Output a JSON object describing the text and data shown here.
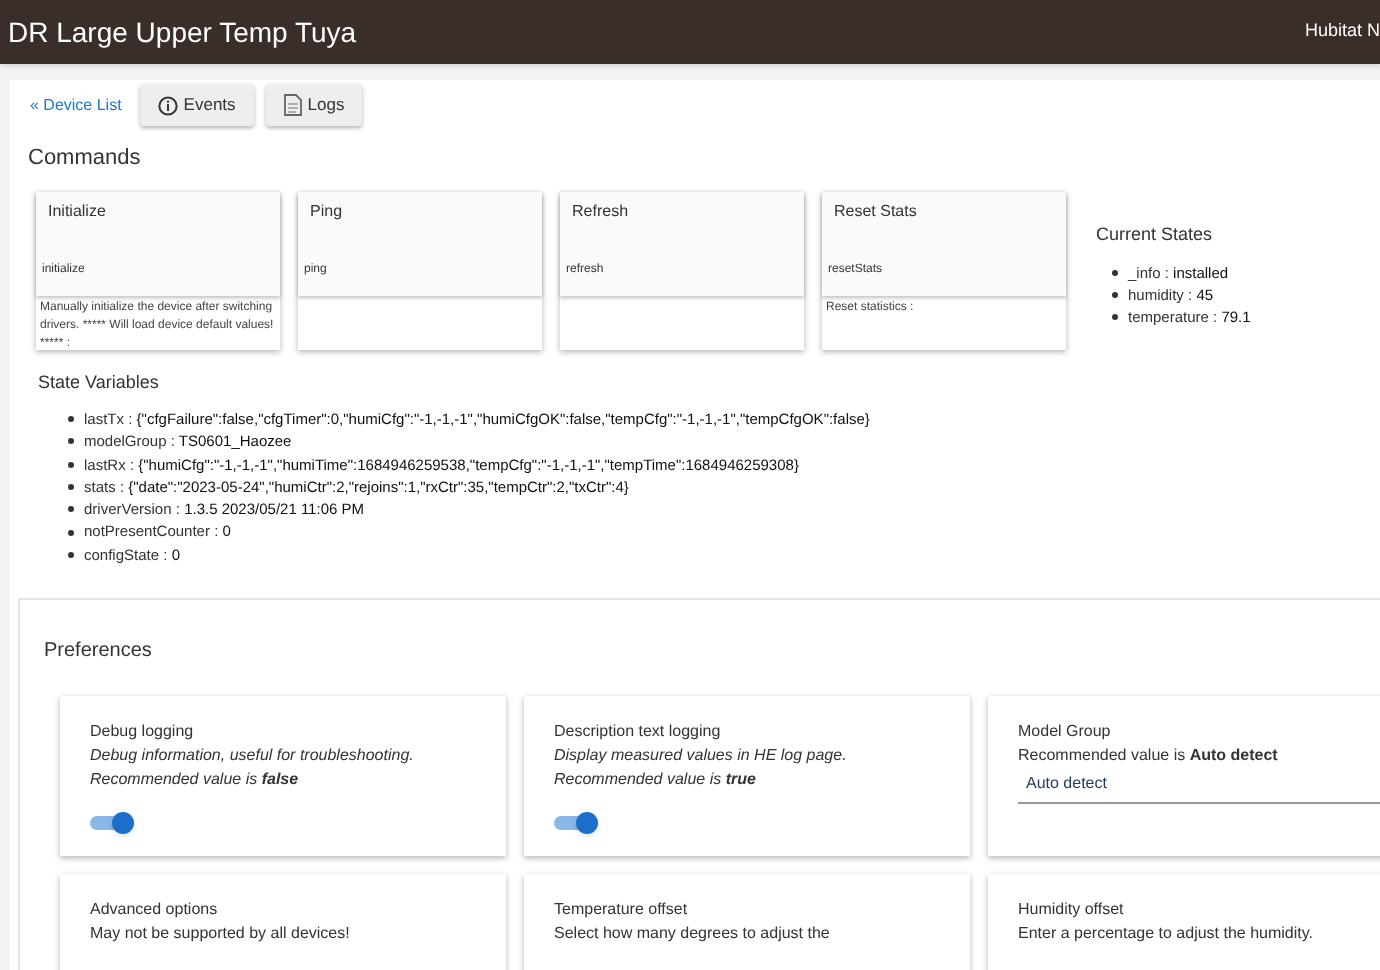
{
  "header": {
    "title": "DR Large Upper Temp Tuya",
    "hub": "Hubitat N"
  },
  "nav": {
    "link": "« Device List",
    "buttons": [
      {
        "kind": "events",
        "label": "Events"
      },
      {
        "kind": "logs",
        "label": "Logs"
      }
    ]
  },
  "commands": {
    "title": "Commands",
    "items": [
      {
        "name": "Initialize",
        "command": "initialize",
        "description": "Manually initialize the device after switching drivers. ***** Will load device default values! ***** :"
      },
      {
        "name": "Ping",
        "command": "ping"
      },
      {
        "name": "Refresh",
        "command": "refresh"
      },
      {
        "name": "Reset Stats",
        "command": "resetStats",
        "description": "Reset statistics :"
      }
    ]
  },
  "current_states": {
    "title": "Current States",
    "separator": ":",
    "items": [
      {
        "name": "_info",
        "value": "installed"
      },
      {
        "name": "humidity",
        "value": "45"
      },
      {
        "name": "temperature",
        "value": "79.1"
      }
    ]
  },
  "state_variables": {
    "title": "State Variables",
    "separator": ":",
    "items": [
      {
        "name": "lastTx",
        "value": "{\"cfgFailure\":false,\"cfgTimer\":0,\"humiCfg\":\"-1,-1,-1\",\"humiCfgOK\":false,\"tempCfg\":\"-1,-1,-1\",\"tempCfgOK\":false}"
      },
      {
        "name": "modelGroup",
        "value": "TS0601_Haozee"
      },
      {
        "name": "lastRx",
        "value": "{\"humiCfg\":\"-1,-1,-1\",\"humiTime\":1684946259538,\"tempCfg\":\"-1,-1,-1\",\"tempTime\":1684946259308}"
      },
      {
        "name": "stats",
        "value": "{\"date\":\"2023-05-24\",\"humiCtr\":2,\"rejoins\":1,\"rxCtr\":35,\"tempCtr\":2,\"txCtr\":4}"
      },
      {
        "name": "driverVersion",
        "value": "1.3.5 2023/05/21 11:06 PM"
      },
      {
        "name": "notPresentCounter",
        "value": "0"
      },
      {
        "name": "configState",
        "value": "0"
      }
    ]
  },
  "preferences": {
    "title": "Preferences",
    "items": [
      {
        "kind": "toggle",
        "title": "Debug logging",
        "description": "Debug information, useful for troubleshooting. Recommended value is **false**",
        "on": true
      },
      {
        "kind": "toggle",
        "title": "Description text logging",
        "description": "Display measured values in HE log page. Recommended value is **true**",
        "on": true
      },
      {
        "kind": "select",
        "title": "Model Group",
        "description": "Recommended value is **Auto detect**",
        "value": "Auto detect"
      },
      {
        "kind": "text",
        "title": "Advanced options",
        "description": "May not be supported by all devices!"
      },
      {
        "kind": "text",
        "title": "Temperature offset",
        "description": "Select how many degrees to adjust the"
      },
      {
        "kind": "text",
        "title": "Humidity offset",
        "description": "Enter a percentage to adjust the humidity."
      }
    ]
  }
}
